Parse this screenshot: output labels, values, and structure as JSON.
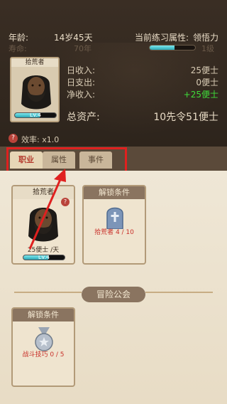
{
  "header": {
    "age_label": "年龄:",
    "age_value": "14岁45天",
    "life_label": "寿命:",
    "life_value": "70年",
    "attr_label": "当前练习属性:",
    "attr_value": "领悟力",
    "attr_level": "1级",
    "attr_progress": 0.55
  },
  "character": {
    "name": "拾荒者",
    "level": "Lv.4"
  },
  "stats": {
    "daily_income_label": "日收入:",
    "daily_income_value": "25便士",
    "daily_expense_label": "日支出:",
    "daily_expense_value": "0便士",
    "net_income_label": "净收入:",
    "net_income_value": "+25便士",
    "assets_label": "总资产:",
    "assets_value": "10先令51便士",
    "efficiency": "效率: x1.0"
  },
  "tabs": [
    {
      "label": "职业",
      "active": true
    },
    {
      "label": "属性",
      "active": false
    },
    {
      "label": "事件",
      "active": false
    }
  ],
  "cards": {
    "job": {
      "title": "拾荒者",
      "wage": "25便士 /天",
      "level": "Lv.4",
      "badge": "?"
    },
    "locked1": {
      "title": "解锁条件",
      "requirement": "拾荒者 4 / 10"
    },
    "guild_title": "冒险公会",
    "locked2": {
      "title": "解锁条件",
      "requirement": "战斗技巧 0 / 5"
    }
  },
  "colors": {
    "header_bg": "#2d241c",
    "accent_red": "#e0201f",
    "xp_bar": "#2aa7b5",
    "positive": "#3fdc3a"
  }
}
